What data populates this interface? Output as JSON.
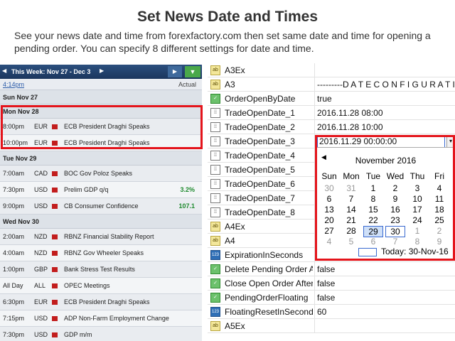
{
  "header": {
    "title": "Set News Date and Times",
    "subtitle": "See your news date and time from forexfactory.com then set same date and time for opening a pending order. You can specify 8 different settings for date and time."
  },
  "calendar": {
    "week_label": "This Week: Nov 27 - Dec 3",
    "current_time": "4:14pm",
    "actual_label": "Actual",
    "days": [
      {
        "label": "Sun Nov 27",
        "events": []
      },
      {
        "label": "Mon Nov 28",
        "events": [
          {
            "time": "8:00pm",
            "currency": "EUR",
            "name": "ECB President Draghi Speaks",
            "actual": ""
          },
          {
            "time": "10:00pm",
            "currency": "EUR",
            "name": "ECB President Draghi Speaks",
            "actual": ""
          }
        ]
      },
      {
        "label": "Tue Nov 29",
        "events": [
          {
            "time": "7:00am",
            "currency": "CAD",
            "name": "BOC Gov Poloz Speaks",
            "actual": ""
          },
          {
            "time": "7:30pm",
            "currency": "USD",
            "name": "Prelim GDP q/q",
            "actual": "3.2%"
          },
          {
            "time": "9:00pm",
            "currency": "USD",
            "name": "CB Consumer Confidence",
            "actual": "107.1"
          }
        ]
      },
      {
        "label": "Wed Nov 30",
        "events": [
          {
            "time": "2:00am",
            "currency": "NZD",
            "name": "RBNZ Financial Stability Report",
            "actual": ""
          },
          {
            "time": "4:00am",
            "currency": "NZD",
            "name": "RBNZ Gov Wheeler Speaks",
            "actual": ""
          },
          {
            "time": "1:00pm",
            "currency": "GBP",
            "name": "Bank Stress Test Results",
            "actual": ""
          },
          {
            "time": "All Day",
            "currency": "ALL",
            "name": "OPEC Meetings",
            "actual": ""
          },
          {
            "time": "6:30pm",
            "currency": "EUR",
            "name": "ECB President Draghi Speaks",
            "actual": ""
          },
          {
            "time": "7:15pm",
            "currency": "USD",
            "name": "ADP Non-Farm Employment Change",
            "actual": ""
          },
          {
            "time": "7:30pm",
            "currency": "USD",
            "name": "GDP m/m",
            "actual": ""
          }
        ]
      }
    ]
  },
  "properties": [
    {
      "icon": "ab",
      "label": "A3Ex",
      "value": ""
    },
    {
      "icon": "ab",
      "label": "A3",
      "value": "---------D A T E  C O N F I G U R A T I O N"
    },
    {
      "icon": "chk",
      "label": "OrderOpenByDate",
      "value": "true"
    },
    {
      "icon": "cal",
      "label": "TradeOpenDate_1",
      "value": "2016.11.28 08:00"
    },
    {
      "icon": "cal",
      "label": "TradeOpenDate_2",
      "value": "2016.11.28 10:00"
    },
    {
      "icon": "cal",
      "label": "TradeOpenDate_3",
      "value": "2016.11.29 00:00:00"
    },
    {
      "icon": "cal",
      "label": "TradeOpenDate_4",
      "value": ""
    },
    {
      "icon": "cal",
      "label": "TradeOpenDate_5",
      "value": ""
    },
    {
      "icon": "cal",
      "label": "TradeOpenDate_6",
      "value": ""
    },
    {
      "icon": "cal",
      "label": "TradeOpenDate_7",
      "value": ""
    },
    {
      "icon": "cal",
      "label": "TradeOpenDate_8",
      "value": ""
    },
    {
      "icon": "ab",
      "label": "A4Ex",
      "value": ""
    },
    {
      "icon": "ab",
      "label": "A4",
      "value": ""
    },
    {
      "icon": "num",
      "label": "ExpirationInSeconds",
      "value": ""
    },
    {
      "icon": "chk",
      "label": "Delete Pending Order Afte",
      "value": "false"
    },
    {
      "icon": "chk",
      "label": "Close Open Order After Ex",
      "value": "false"
    },
    {
      "icon": "chk",
      "label": "PendingOrderFloating",
      "value": "false"
    },
    {
      "icon": "num",
      "label": "FloatingResetInSeconds",
      "value": "60"
    },
    {
      "icon": "ab",
      "label": "A5Ex",
      "value": ""
    }
  ],
  "picker": {
    "month": "November 2016",
    "dows": [
      "Sun",
      "Mon",
      "Tue",
      "Wed",
      "Thu",
      "Fri"
    ],
    "weeks": [
      [
        "30",
        "31",
        "1",
        "2",
        "3",
        "4"
      ],
      [
        "6",
        "7",
        "8",
        "9",
        "10",
        "11"
      ],
      [
        "13",
        "14",
        "15",
        "16",
        "17",
        "18"
      ],
      [
        "20",
        "21",
        "22",
        "23",
        "24",
        "25"
      ],
      [
        "27",
        "28",
        "29",
        "30",
        "1",
        "2"
      ],
      [
        "4",
        "5",
        "6",
        "7",
        "8",
        "9"
      ]
    ],
    "today_label": "Today: 30-Nov-16"
  },
  "icon_labels": {
    "ab": "ab",
    "cal": "⁞⁞",
    "chk": "✓",
    "num": "123"
  },
  "colors": {
    "highlight": "#e4141b",
    "header_bg": "#1b365d",
    "flag": "#c21d1d",
    "actual_positive": "#1e8a2e"
  }
}
